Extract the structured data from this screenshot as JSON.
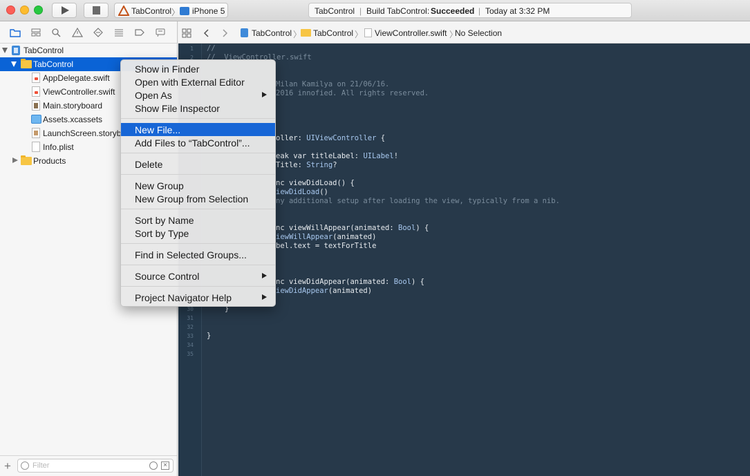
{
  "toolbar": {
    "scheme": {
      "project": "TabControl",
      "device": "iPhone 5"
    },
    "status": {
      "project": "TabControl",
      "build_prefix": "Build TabControl:",
      "build_result": "Succeeded",
      "time": "Today at 3:32 PM"
    }
  },
  "jumpbar": {
    "crumbs": [
      "TabControl",
      "TabControl",
      "ViewController.swift",
      "No Selection"
    ]
  },
  "navigator": {
    "project": "TabControl",
    "group": "TabControl",
    "files": [
      "AppDelegate.swift",
      "ViewController.swift",
      "Main.storyboard",
      "Assets.xcassets",
      "LaunchScreen.storyb",
      "Info.plist"
    ],
    "products": "Products",
    "filter_placeholder": "Filter"
  },
  "editor": {
    "line_numbers_top": [
      "1",
      "2"
    ],
    "line_numbers_bottom": [
      "30",
      "31",
      "32",
      "33",
      "34",
      "35"
    ],
    "lines": [
      {
        "text": "//",
        "cls": "cmt"
      },
      {
        "text": "//  ViewController.swift",
        "cls": "cmt"
      },
      {
        "text": "Milan Kamilya on 21/06/16.",
        "cls": "cmt"
      },
      {
        "text": "2016 innofied. All rights reserved.",
        "cls": "cmt"
      },
      {
        "text": "oller: ",
        "cls": ""
      },
      {
        "text": "UIViewController",
        "cls": "typ"
      },
      {
        "text": " {",
        "cls": ""
      },
      {
        "text": "eak var titleLabel: ",
        "cls": ""
      },
      {
        "text": "UILabel",
        "cls": "typ"
      },
      {
        "text": "!",
        "cls": ""
      },
      {
        "text": "Title: ",
        "cls": ""
      },
      {
        "text": "String",
        "cls": "typ"
      },
      {
        "text": "?",
        "cls": ""
      },
      {
        "text": "nc viewDidLoad() {",
        "cls": ""
      },
      {
        "text": "iewDidLoad",
        "cls": "typ"
      },
      {
        "text": "()",
        "cls": ""
      },
      {
        "text": "ny additional setup after loading the view, typically from a nib.",
        "cls": "cmt"
      },
      {
        "text": "nc viewWillAppear(animated: ",
        "cls": ""
      },
      {
        "text": "Bool",
        "cls": "typ"
      },
      {
        "text": ") {",
        "cls": ""
      },
      {
        "text": "iewWillAppear",
        "cls": "typ"
      },
      {
        "text": "(animated)",
        "cls": ""
      },
      {
        "text": "bel.text = textForTitle",
        "cls": ""
      },
      {
        "text": "nc viewDidAppear(animated: ",
        "cls": ""
      },
      {
        "text": "Bool",
        "cls": "typ"
      },
      {
        "text": ") {",
        "cls": ""
      },
      {
        "text": "iewDidAppear",
        "cls": "typ"
      },
      {
        "text": "(animated)",
        "cls": ""
      },
      {
        "text": "}",
        "cls": ""
      },
      {
        "text": "}",
        "cls": ""
      }
    ]
  },
  "context_menu": {
    "items": [
      "Show in Finder",
      "Open with External Editor",
      "Open As",
      "Show File Inspector",
      "New File...",
      "Add Files to “TabControl”...",
      "Delete",
      "New Group",
      "New Group from Selection",
      "Sort by Name",
      "Sort by Type",
      "Find in Selected Groups...",
      "Source Control",
      "Project Navigator Help"
    ],
    "highlighted": "New File..."
  },
  "colors": {
    "selection": "#0a63d6",
    "editor_bg": "#27394a",
    "menu_highlight": "#1766d6",
    "type_color": "#a7c7ee"
  }
}
